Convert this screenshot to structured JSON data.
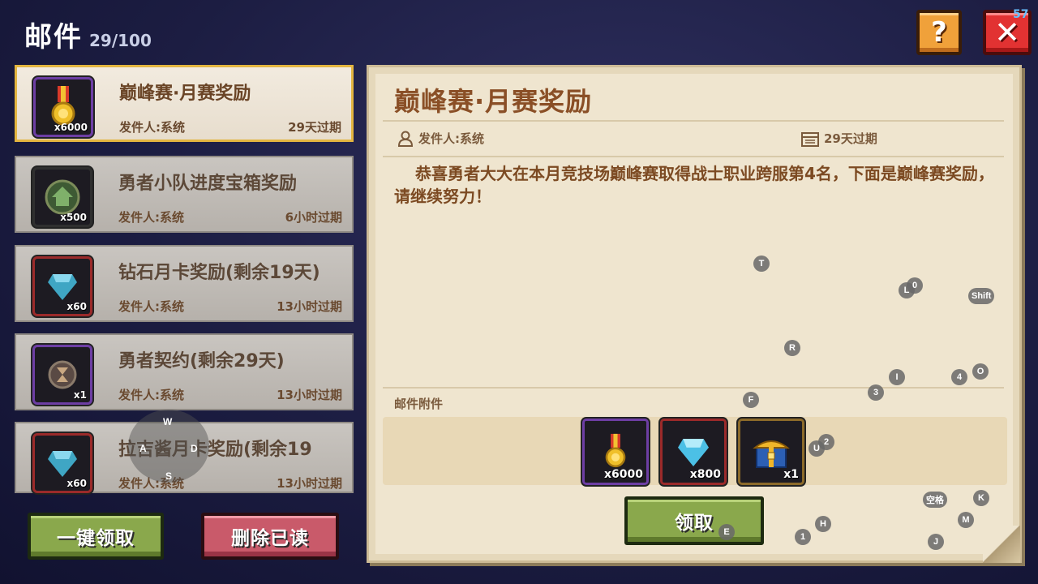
{
  "header": {
    "title": "邮件",
    "count": "29/100"
  },
  "top_buttons": {
    "help_label": "?",
    "close_label": "✕",
    "fps": "57"
  },
  "mail_list": [
    {
      "title": "巅峰赛·月赛奖励",
      "sender": "发件人:系统",
      "expire": "29天过期",
      "qty": "x6000",
      "icon": "medal-icon"
    },
    {
      "title": "勇者小队进度宝箱奖励",
      "sender": "发件人:系统",
      "expire": "6小时过期",
      "qty": "x500",
      "icon": "house-icon"
    },
    {
      "title": "钻石月卡奖励(剩余19天)",
      "sender": "发件人:系统",
      "expire": "13小时过期",
      "qty": "x60",
      "icon": "diamond-icon"
    },
    {
      "title": "勇者契约(剩余29天)",
      "sender": "发件人:系统",
      "expire": "13小时过期",
      "qty": "x1",
      "icon": "hourglass-icon"
    },
    {
      "title": "拉吉酱月卡奖励(剩余19",
      "sender": "发件人:系统",
      "expire": "13小时过期",
      "qty": "x60",
      "icon": "diamond-icon"
    }
  ],
  "list_buttons": {
    "claim_all": "一键领取",
    "delete_read": "删除已读"
  },
  "detail": {
    "title": "巅峰赛·月赛奖励",
    "sender": "发件人:系统",
    "expire": "29天过期",
    "body": "恭喜勇者大大在本月竞技场巅峰赛取得战士职业跨服第4名，下面是巅峰赛奖励，请继续努力！",
    "attachments_label": "邮件附件",
    "attachments": [
      {
        "qty": "x6000",
        "icon": "medal-icon"
      },
      {
        "qty": "x800",
        "icon": "diamond-icon"
      },
      {
        "qty": "x1",
        "icon": "treasure-chest-icon"
      }
    ],
    "claim_label": "领取"
  },
  "key_hints": {
    "T": "T",
    "L": "L",
    "zero": "0",
    "shift": "Shift",
    "R": "R",
    "I": "I",
    "four": "4",
    "O": "O",
    "three": "3",
    "F": "F",
    "U": "U",
    "two": "2",
    "space": "空格",
    "K": "K",
    "M": "M",
    "H": "H",
    "one": "1",
    "J": "J",
    "E": "E"
  },
  "joystick": {
    "up": "W",
    "left": "A",
    "right": "D",
    "down": "S"
  }
}
